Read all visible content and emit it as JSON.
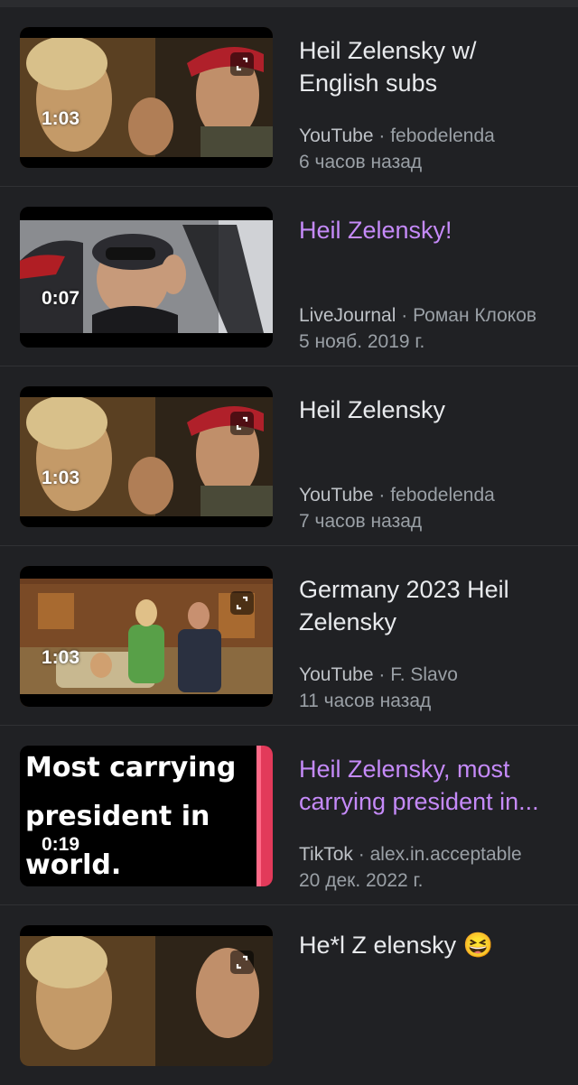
{
  "results": [
    {
      "title": "Heil Zelensky w/ English subs",
      "source": "YouTube",
      "author": "febodelenda",
      "date": "6 часов назад",
      "duration": "1:03",
      "visited": false,
      "thumbnail": "military-scene"
    },
    {
      "title": "Heil Zelensky!",
      "source": "LiveJournal",
      "author": "Роман Клоков",
      "date": "5 нояб. 2019 г.",
      "duration": "0:07",
      "visited": true,
      "thumbnail": "car-man"
    },
    {
      "title": "Heil Zelensky",
      "source": "YouTube",
      "author": "febodelenda",
      "date": "7 часов назад",
      "duration": "1:03",
      "visited": false,
      "thumbnail": "military-scene"
    },
    {
      "title": "Germany 2023 Heil Zelensky",
      "source": "YouTube",
      "author": "F. Slavo",
      "date": "11 часов назад",
      "duration": "1:03",
      "visited": false,
      "thumbnail": "living-room"
    },
    {
      "title": "Heil Zelensky, most carrying president in...",
      "source": "TikTok",
      "author": "alex.in.acceptable",
      "date": "20 дек. 2022 г.",
      "duration": "0:19",
      "visited": true,
      "thumbnail": "tiktok-text",
      "thumbnail_text": [
        "Most carrying",
        "president in",
        "world."
      ]
    },
    {
      "title": "He*l Z elensky 😆",
      "source": "",
      "author": "",
      "date": "",
      "duration": "",
      "visited": false,
      "thumbnail": "military-scene"
    }
  ],
  "separator": "·"
}
